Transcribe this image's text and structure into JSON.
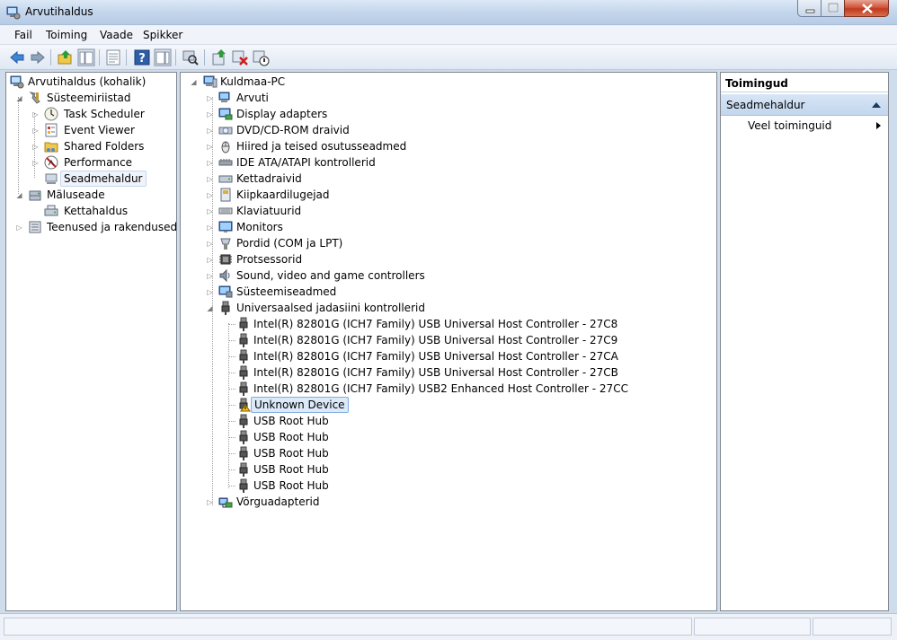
{
  "window": {
    "title": "Arvutihaldus"
  },
  "menu": [
    "Fail",
    "Toiming",
    "Vaade",
    "Spikker"
  ],
  "toolbar": [
    "back-icon",
    "forward-icon",
    "up-icon",
    "show-hide-tree-icon",
    "properties-icon",
    "help-icon",
    "show-hide-action-pane-icon",
    "scan-hardware-icon",
    "update-driver-icon",
    "uninstall-icon",
    "disable-icon"
  ],
  "left_tree": {
    "root": "Arvutihaldus (kohalik)",
    "system_tools": "Süsteemiriistad",
    "task_scheduler": "Task Scheduler",
    "event_viewer": "Event Viewer",
    "shared_folders": "Shared Folders",
    "performance": "Performance",
    "device_manager": "Seadmehaldur",
    "storage": "Mäluseade",
    "disk_management": "Kettahaldus",
    "services": "Teenused ja rakendused"
  },
  "device_tree": {
    "computer": "Kuldmaa-PC",
    "categories": [
      "Arvuti",
      "Display adapters",
      "DVD/CD-ROM draivid",
      "Hiired ja teised osutusseadmed",
      "IDE ATA/ATAPI kontrollerid",
      "Kettadraivid",
      "Kiipkaardilugejad",
      "Klaviatuurid",
      "Monitors",
      "Pordid (COM ja LPT)",
      "Protsessorid",
      "Sound, video and game controllers",
      "Süsteemiseadmed"
    ],
    "usb_category": "Universaalsed jadasiini kontrollerid",
    "usb_devices": [
      "Intel(R) 82801G (ICH7 Family) USB Universal Host Controller - 27C8",
      "Intel(R) 82801G (ICH7 Family) USB Universal Host Controller - 27C9",
      "Intel(R) 82801G (ICH7 Family) USB Universal Host Controller - 27CA",
      "Intel(R) 82801G (ICH7 Family) USB Universal Host Controller - 27CB",
      "Intel(R) 82801G (ICH7 Family) USB2 Enhanced Host Controller - 27CC",
      "Unknown Device",
      "USB Root Hub",
      "USB Root Hub",
      "USB Root Hub",
      "USB Root Hub",
      "USB Root Hub"
    ],
    "network_category": "Võrguadapterid"
  },
  "actions": {
    "header": "Toimingud",
    "group": "Seadmehaldur",
    "more": "Veel toiminguid"
  }
}
